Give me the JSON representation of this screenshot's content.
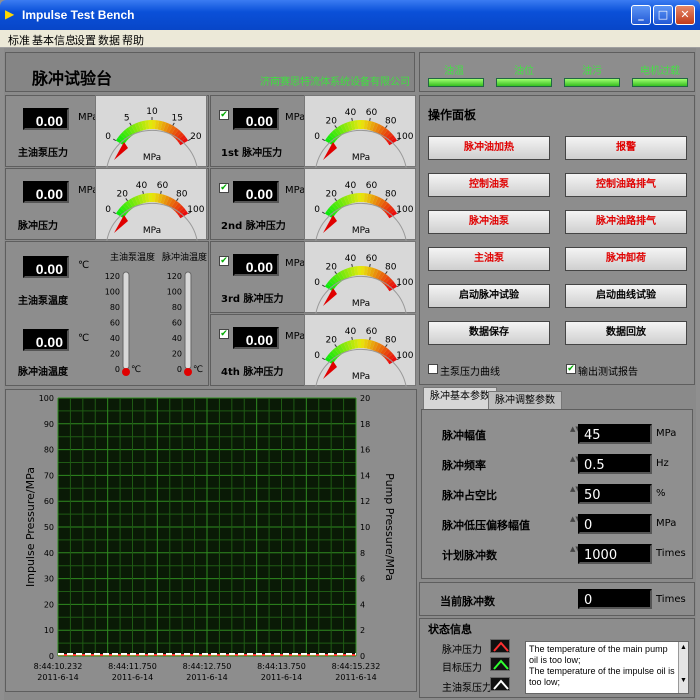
{
  "window": {
    "title": "Impulse Test Bench",
    "btn_min": "_",
    "btn_max": "□",
    "btn_close": "✕"
  },
  "menu": [
    "标准",
    "基本信息",
    "设置",
    "数据",
    "帮助"
  ],
  "header": {
    "title": "脉冲试验台",
    "company": "济南赛思特流体系统设备有限公司"
  },
  "indicators": [
    {
      "label": "油温",
      "color": "#46e046"
    },
    {
      "label": "油位",
      "color": "#46e046"
    },
    {
      "label": "油污",
      "color": "#46e046"
    },
    {
      "label": "电机过载",
      "color": "#46e046"
    }
  ],
  "readouts": {
    "main_pump_pressure": {
      "value": "0.00",
      "unit": "MPa",
      "label": "主油泵压力"
    },
    "impulse_pressure": {
      "value": "0.00",
      "unit": "MPa",
      "label": "脉冲压力"
    },
    "main_pump_temp": {
      "value": "0.00",
      "unit": "℃",
      "label": "主油泵温度"
    },
    "impulse_oil_temp": {
      "value": "0.00",
      "unit": "℃",
      "label": "脉冲油温度"
    },
    "p1": {
      "value": "0.00",
      "unit": "MPa",
      "label": "1st 脉冲压力",
      "checked": true
    },
    "p2": {
      "value": "0.00",
      "unit": "MPa",
      "label": "2nd 脉冲压力",
      "checked": true
    },
    "p3": {
      "value": "0.00",
      "unit": "MPa",
      "label": "3rd 脉冲压力",
      "checked": true
    },
    "p4": {
      "value": "0.00",
      "unit": "MPa",
      "label": "4th 脉冲压力",
      "checked": true
    }
  },
  "gauges": {
    "g0": {
      "ticks": [
        "0",
        "5",
        "10",
        "15",
        "20"
      ],
      "unit": "MPa",
      "max": 20,
      "value": 0
    },
    "g100": {
      "ticks": [
        "0",
        "20",
        "40",
        "60",
        "80",
        "100"
      ],
      "unit": "MPa",
      "max": 100,
      "value": 0
    }
  },
  "thermometers": {
    "t1": {
      "title": "主油泵温度",
      "ticks": [
        "120",
        "100",
        "80",
        "60",
        "40",
        "20",
        "0"
      ],
      "unit": "℃",
      "value": 0
    },
    "t2": {
      "title": "脉冲油温度",
      "ticks": [
        "120",
        "100",
        "80",
        "60",
        "40",
        "20",
        "0"
      ],
      "unit": "℃",
      "value": 0
    }
  },
  "ops": {
    "title": "操作面板",
    "buttons": [
      {
        "label": "脉冲油加热",
        "color": "red"
      },
      {
        "label": "报警",
        "color": "red"
      },
      {
        "label": "控制油泵",
        "color": "red"
      },
      {
        "label": "控制油路排气",
        "color": "red"
      },
      {
        "label": "脉冲油泵",
        "color": "red"
      },
      {
        "label": "脉冲油路排气",
        "color": "red"
      },
      {
        "label": "主油泵",
        "color": "red"
      },
      {
        "label": "脉冲卸荷",
        "color": "red"
      },
      {
        "label": "启动脉冲试验",
        "color": "blk"
      },
      {
        "label": "启动曲线试验",
        "color": "blk"
      },
      {
        "label": "数据保存",
        "color": "blk"
      },
      {
        "label": "数据回放",
        "color": "blk"
      }
    ],
    "check_curve": {
      "label": "主泵压力曲线",
      "checked": false
    },
    "check_report": {
      "label": "输出测试报告",
      "checked": true
    }
  },
  "tabs": [
    {
      "label": "脉冲基本参数",
      "active": true
    },
    {
      "label": "脉冲调整参数",
      "active": false
    }
  ],
  "params": [
    {
      "label": "脉冲幅值",
      "value": "45",
      "unit": "MPa"
    },
    {
      "label": "脉冲频率",
      "value": "0.5",
      "unit": "Hz"
    },
    {
      "label": "脉冲占空比",
      "value": "50",
      "unit": "%"
    },
    {
      "label": "脉冲低压偏移幅值",
      "value": "0",
      "unit": "MPa"
    },
    {
      "label": "计划脉冲数",
      "value": "1000",
      "unit": "Times"
    }
  ],
  "current_count": {
    "label": "当前脉冲数",
    "value": "0",
    "unit": "Times"
  },
  "status": {
    "title": "状态信息",
    "legend": [
      {
        "label": "脉冲压力",
        "color": "#ff3030"
      },
      {
        "label": "目标压力",
        "color": "#30ff30"
      },
      {
        "label": "主油泵压力",
        "color": "#ffffff"
      }
    ],
    "messages": [
      "The temperature of the main pump oil is too low;",
      "The temperature of the impulse oil is too low;"
    ]
  },
  "chart_data": {
    "type": "line",
    "ylabel": "Impulse Pressure/MPa",
    "y2label": "Pump Pressure/MPa",
    "ylim": [
      0,
      100
    ],
    "y2lim": [
      0,
      20
    ],
    "yticks": [
      "100",
      "90",
      "80",
      "70",
      "60",
      "50",
      "40",
      "30",
      "20",
      "10",
      "0"
    ],
    "y2ticks": [
      "20",
      "18",
      "16",
      "14",
      "12",
      "10",
      "8",
      "6",
      "4",
      "2",
      "0"
    ],
    "xticks": [
      {
        "time": "8:44:10.232",
        "date": "2011-6-14"
      },
      {
        "time": "8:44:11.750",
        "date": "2011-6-14"
      },
      {
        "time": "8:44:12.750",
        "date": "2011-6-14"
      },
      {
        "time": "8:44:13.750",
        "date": "2011-6-14"
      },
      {
        "time": "8:44:15.232",
        "date": "2011-6-14"
      }
    ],
    "grid": true,
    "series": [
      {
        "name": "脉冲压力",
        "color": "#ff3030",
        "values": [
          0,
          0,
          0,
          0,
          0
        ]
      },
      {
        "name": "目标压力",
        "color": "#30ff30",
        "values": [
          0,
          0,
          0,
          0,
          0
        ]
      },
      {
        "name": "主油泵压力",
        "color": "#ffffff",
        "values": [
          0,
          0,
          0,
          0,
          0
        ]
      }
    ]
  }
}
